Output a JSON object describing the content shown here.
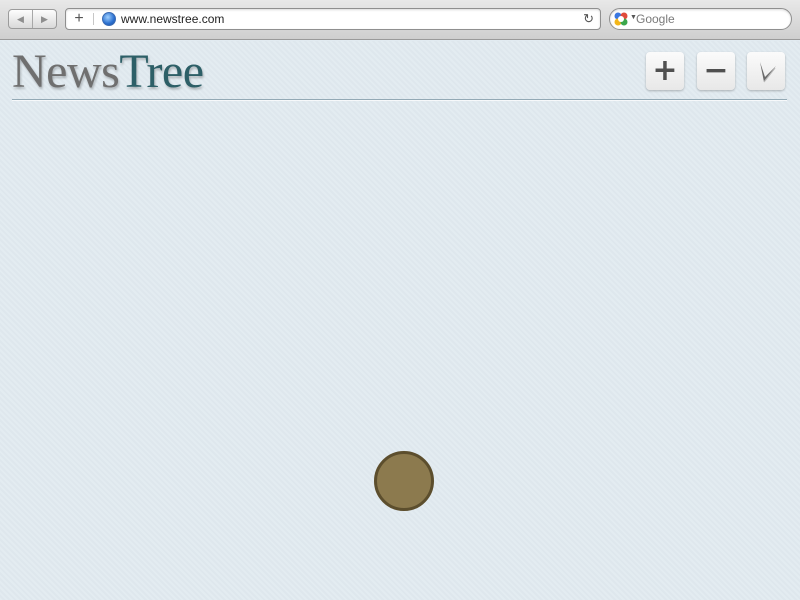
{
  "browser": {
    "url": "www.newstree.com",
    "search_placeholder": "Google",
    "add_bookmark_glyph": "+",
    "reload_glyph": "↻",
    "back_glyph": "◀",
    "forward_glyph": "▶",
    "icons": [
      "back-icon",
      "forward-icon",
      "add-bookmark-icon",
      "globe-icon",
      "reload-icon",
      "google-icon"
    ]
  },
  "page": {
    "logo_part1": "News",
    "logo_part2": "Tree",
    "controls": {
      "zoom_in_glyph": "+",
      "zoom_out_glyph": "−",
      "icons": [
        "plus-icon",
        "minus-icon",
        "clock-icon"
      ]
    },
    "colors": {
      "background": "#e1eaf0",
      "logo_news": "#6f6f6f",
      "logo_tree": "#2d5f67",
      "node_fill": "#8c7a4e",
      "node_stroke": "#5c4e2d"
    }
  }
}
